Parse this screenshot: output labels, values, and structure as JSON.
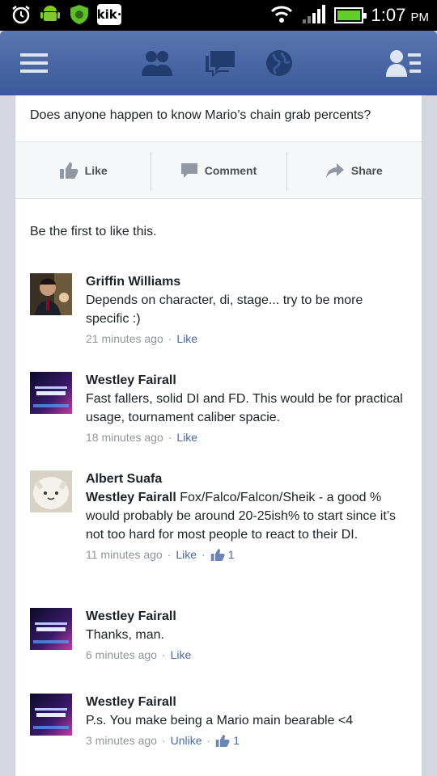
{
  "status_bar": {
    "time": "1:07",
    "ampm": "PM",
    "kik_label": "kik·"
  },
  "header": {
    "icons": [
      "menu-icon",
      "friends-icon",
      "messages-icon",
      "globe-icon",
      "profile-list-icon"
    ]
  },
  "post": {
    "text": "Does anyone happen to know Mario’s chain grab percents?",
    "actions": {
      "like": "Like",
      "comment": "Comment",
      "share": "Share"
    },
    "likes_summary": "Be the first to like this."
  },
  "comments": [
    {
      "name": "Griffin Williams",
      "text": "Depends on character, di, stage... try to be more specific :)",
      "time": "21 minutes ago",
      "action": "Like"
    },
    {
      "name": "Westley Fairall",
      "text": "Fast fallers, solid DI and FD. This would be for practical usage, tournament caliber spacie.",
      "time": "18 minutes ago",
      "action": "Like"
    },
    {
      "name": "Albert Suafa",
      "mention": "Westley Fairall",
      "text": "Fox/Falco/Falcon/Sheik - a good % would probably be around 20-25ish% to start since it’s not too hard for most people to react to their DI.",
      "time": "11 minutes ago",
      "action": "Like",
      "like_count": "1"
    },
    {
      "name": "Westley Fairall",
      "text": "Thanks, man.",
      "time": "6 minutes ago",
      "action": "Like"
    },
    {
      "name": "Westley Fairall",
      "text": "P.s. You make being a Mario main bearable <4",
      "time": "3 minutes ago",
      "action": "Unlike",
      "like_count": "1"
    }
  ],
  "colors": {
    "fb_blue": "#3b5998",
    "link": "#4b67a1",
    "meta": "#90949c"
  }
}
